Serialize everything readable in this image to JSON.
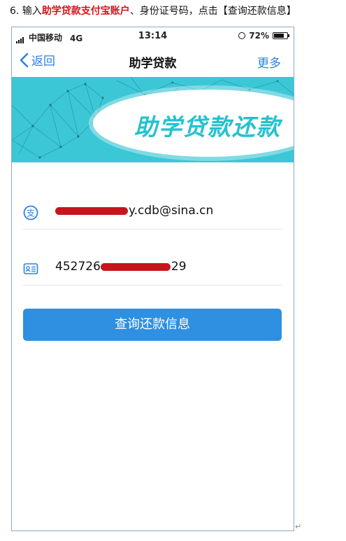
{
  "instruction": {
    "prefix": "6. 输入",
    "highlight": "助学贷款支付宝账户",
    "suffix": "、身份证号码，点击【查询还款信息】"
  },
  "status_bar": {
    "carrier": "中国移动",
    "network": "4G",
    "time": "13:14",
    "battery": "72%"
  },
  "nav": {
    "back_label": "返回",
    "title": "助学贷款",
    "more_label": "更多"
  },
  "banner": {
    "title": "助学贷款还款"
  },
  "form": {
    "alipay_account_visible": "y.cdb@sina.cn",
    "id_prefix": "452726",
    "id_suffix": "29"
  },
  "query_button": "查询还款信息",
  "return_mark": "↵",
  "colors": {
    "accent": "#2a83de",
    "button": "#2f8fe0",
    "banner": "#3cc7d6",
    "highlight_red": "#d4151c",
    "redaction": "#c8141b"
  }
}
